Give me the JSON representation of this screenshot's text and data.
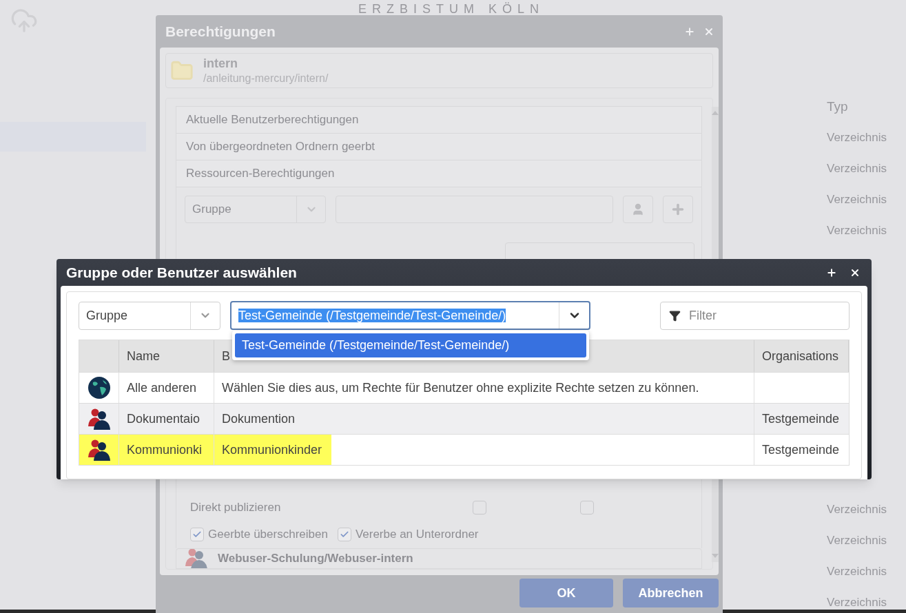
{
  "background": {
    "logo": "ERZBISTUM KÖLN",
    "type_header": "Typ",
    "type_rows_above": [
      "Verzeichnis",
      "Verzeichnis",
      "Verzeichnis",
      "Verzeichnis"
    ],
    "type_rows_below": [
      "Verzeichnis",
      "Verzeichnis",
      "Verzeichnis",
      "Verzeichnis"
    ]
  },
  "permissions_dialog": {
    "title": "Berechtigungen",
    "resource": {
      "name": "intern",
      "path": "/anleitung-mercury/intern/"
    },
    "sections": [
      {
        "label": "Aktuelle Benutzerberechtigungen"
      },
      {
        "label": "Von übergeordneten Ordnern geerbt"
      },
      {
        "label": "Ressourcen-Berechtigungen"
      }
    ],
    "type_select": "Gruppe",
    "permission_row": {
      "label": "Direkt publizieren",
      "checks": [
        false,
        false
      ]
    },
    "options": [
      {
        "label": "Geerbte überschreiben",
        "checked": true
      },
      {
        "label": "Vererbe an Unterordner",
        "checked": true
      }
    ],
    "group_entry": "Webuser-Schulung/Webuser-intern",
    "buttons": [
      "OK",
      "Abbrechen"
    ]
  },
  "select_dialog": {
    "title": "Gruppe oder Benutzer auswählen",
    "type_select": "Gruppe",
    "combo_value": "Test-Gemeinde (/Testgemeinde/Test-Gemeinde/)",
    "combo_options": [
      {
        "label": "Test-Gemeinde (/Testgemeinde/Test-Gemeinde/)",
        "selected": true
      }
    ],
    "filter": {
      "placeholder": "Filter"
    },
    "columns": [
      "",
      "Name",
      "B",
      "Organisations"
    ],
    "rows": [
      {
        "kind": "everyone",
        "name": "Alle anderen",
        "description": "Wählen Sie dies aus, um Rechte für Benutzer ohne explizite Rechte setzen zu können.",
        "organisation": "",
        "hovered": false,
        "highlighted": false
      },
      {
        "kind": "group",
        "name": "Dokumentaio",
        "description": "Dokumention",
        "organisation": "Testgemeinde",
        "hovered": true,
        "highlighted": false
      },
      {
        "kind": "group",
        "name": "Kommunionki",
        "description": "Kommunionkinder",
        "organisation": "Testgemeinde",
        "hovered": false,
        "highlighted": true
      }
    ]
  }
}
